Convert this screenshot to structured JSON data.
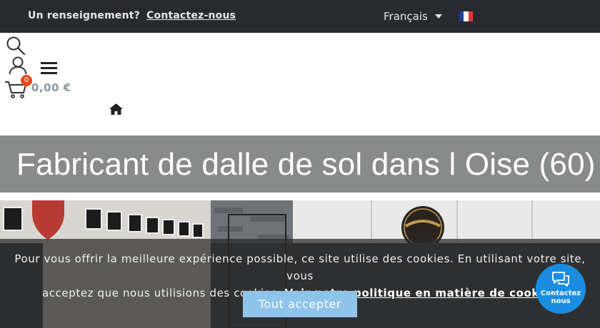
{
  "topbar": {
    "question": "Un renseignement?",
    "contact_link": "Contactez-nous",
    "language": "Français",
    "flag_colors": [
      "#1f3f95",
      "#ffffff",
      "#e53935"
    ]
  },
  "header": {
    "search_icon": "search-icon",
    "account_icon": "user-icon",
    "menu_icon": "hamburger-menu-icon",
    "cart_icon": "cart-icon",
    "home_icon": "home-icon",
    "cart_count": "0",
    "cart_total": "0,00 €"
  },
  "page": {
    "title": "Fabricant de dalle de sol dans l Oise (60)"
  },
  "cookie_banner": {
    "text_line1": "Pour vous offrir la meilleure expérience possible, ce site utilise des cookies. En utilisant votre site, vous",
    "text_line2": "acceptez que nous utilisions des cookies.",
    "policy_link": "Voir notre politique en matière de cookies",
    "accept_label": "Tout accepter"
  },
  "contact_widget": {
    "label_line1": "Contactez",
    "label_line2": "nous",
    "icon": "chat-icon"
  },
  "colors": {
    "topbar_bg": "#282a30",
    "title_band_bg": "#898a8a",
    "accept_button": "#8ec4ea",
    "contact_bubble": "#1a8de0",
    "cart_badge": "#e64a19"
  }
}
